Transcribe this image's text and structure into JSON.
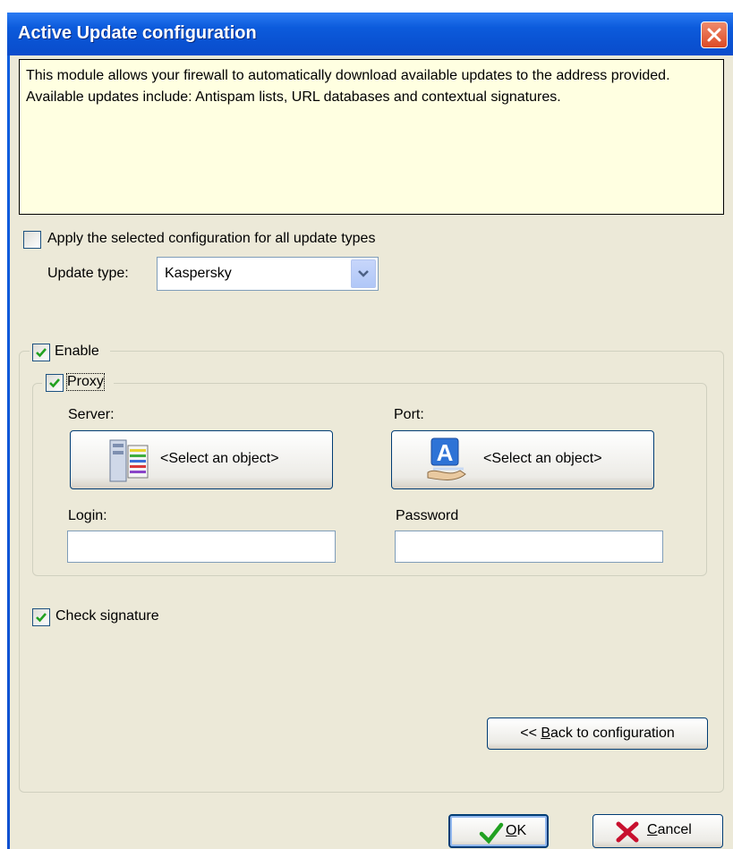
{
  "window": {
    "title": "Active Update configuration"
  },
  "info_text": "This module allows your firewall to automatically download available updates to the address provided. Available updates include: Antispam lists, URL databases and contextual signatures.",
  "apply_all": {
    "label": "Apply the selected configuration for all update types",
    "checked": false
  },
  "update_type": {
    "label": "Update type:",
    "value": "Kaspersky"
  },
  "enable": {
    "label": "Enable",
    "checked": true
  },
  "proxy": {
    "label": "Proxy",
    "checked": true
  },
  "server": {
    "label": "Server:",
    "button": "<Select an object>"
  },
  "port": {
    "label": "Port:",
    "button": "<Select an object>"
  },
  "login": {
    "label": "Login:",
    "value": ""
  },
  "password": {
    "label": "Password",
    "value": ""
  },
  "check_signature": {
    "label": "Check signature",
    "checked": true
  },
  "back_button": {
    "prefix": "<< ",
    "accel": "B",
    "rest": "ack to configuration"
  },
  "ok_button": {
    "accel": "O",
    "rest": "K"
  },
  "cancel_button": {
    "accel": "C",
    "rest": "ancel"
  },
  "colors": {
    "titlebar": "#0a52d2",
    "panel": "#ece9d8",
    "info_bg": "#ffffe1",
    "check": "#21a121",
    "cancel_x": "#c8102e"
  }
}
